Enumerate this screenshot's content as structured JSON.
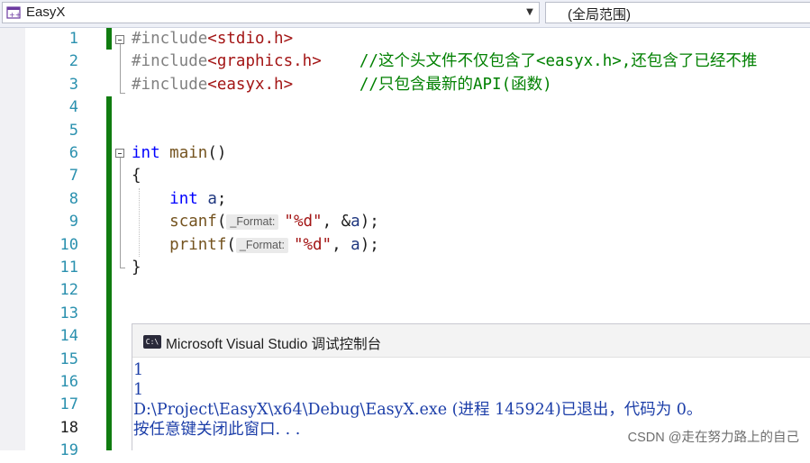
{
  "toolbar": {
    "project_name": "EasyX",
    "scope_label": "(全局范围)",
    "dropdown_glyph": "▼"
  },
  "editor": {
    "line_numbers": [
      "1",
      "2",
      "3",
      "4",
      "5",
      "6",
      "7",
      "8",
      "9",
      "10",
      "11",
      "12",
      "13",
      "14",
      "15",
      "16",
      "17",
      "18",
      "19"
    ],
    "current_line": 18,
    "code": {
      "l1": {
        "directive": "#include",
        "header": "<stdio.h>"
      },
      "l2": {
        "directive": "#include",
        "header": "<graphics.h>",
        "gap": "    ",
        "comment": "//这个头文件不仅包含了<easyx.h>,还包含了已经不推"
      },
      "l3": {
        "directive": "#include",
        "header": "<easyx.h>",
        "gap": "       ",
        "comment": "//只包含最新的API(函数)"
      },
      "l6": {
        "type": "int",
        "space": " ",
        "name": "main",
        "parens": "()"
      },
      "l7": {
        "brace": "{"
      },
      "l8": {
        "indent": "    ",
        "type": "int",
        "space": " ",
        "var": "a",
        "semi": ";"
      },
      "l9": {
        "indent": "    ",
        "func": "scanf",
        "open": "(",
        "hint": "_Format:",
        "fmt": "\"%d\"",
        "sep": ", &",
        "arg": "a",
        "close": ");"
      },
      "l10": {
        "indent": "    ",
        "func": "printf",
        "open": "(",
        "hint": "_Format:",
        "fmt": "\"%d\"",
        "sep": ", ",
        "arg": "a",
        "close": ");"
      },
      "l11": {
        "brace": "}"
      }
    }
  },
  "console": {
    "icon_label": "C:\\",
    "title": "Microsoft Visual Studio 调试控制台",
    "lines": [
      "1",
      "1",
      "D:\\Project\\EasyX\\x64\\Debug\\EasyX.exe (进程 145924)已退出，代码为 0。",
      "按任意键关闭此窗口. . ."
    ]
  },
  "watermark": "CSDN @走在努力路上的自己",
  "colors": {
    "line_number": "#2b91af",
    "preprocessor": "#808080",
    "include_path": "#a31515",
    "comment": "#008000",
    "keyword": "#0000ff",
    "function": "#74531f",
    "variable": "#1f377f",
    "string": "#a31515",
    "change_bar": "#107c10",
    "console_text": "#1c3ea8"
  }
}
